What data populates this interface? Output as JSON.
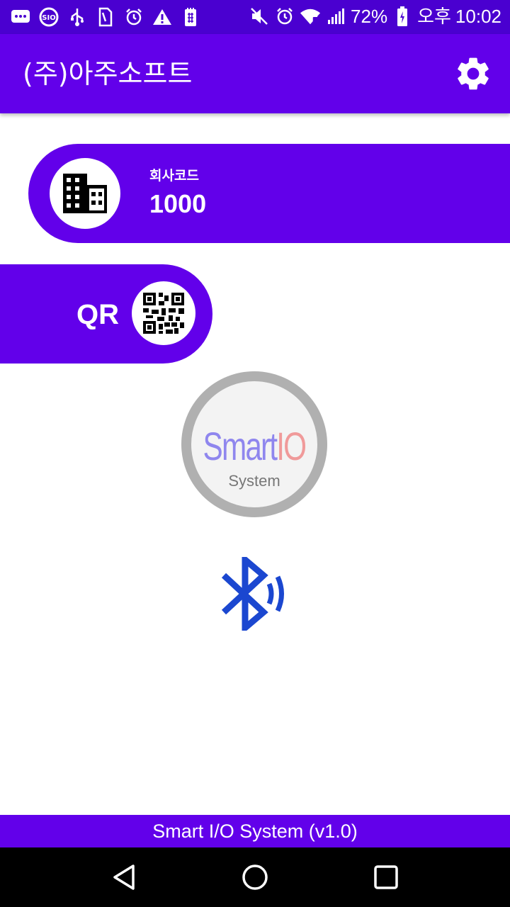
{
  "status_bar": {
    "battery_percent": "72%",
    "ampm": "오후",
    "time": "10:02",
    "left_icons": [
      "message-icon",
      "sio-app-icon",
      "usb-icon",
      "sim-icon",
      "alarm-icon",
      "warning-icon",
      "storage-icon"
    ],
    "right_icons": [
      "mute-icon",
      "alarm-icon",
      "wifi-icon",
      "signal-icon",
      "battery-icon"
    ]
  },
  "app_bar": {
    "title": "(주)아주소프트",
    "settings_icon": "gear-icon"
  },
  "company": {
    "label": "회사코드",
    "value": "1000",
    "icon": "building-icon"
  },
  "qr": {
    "label": "QR",
    "icon": "qr-code-icon"
  },
  "logo": {
    "smart": "Smart",
    "io": "IO",
    "system": "System"
  },
  "bluetooth": {
    "icon": "bluetooth-audio-icon"
  },
  "footer": {
    "text": "Smart I/O System (v1.0)"
  },
  "nav_bar": {
    "icons": [
      "back-icon",
      "home-icon",
      "recents-icon"
    ]
  },
  "colors": {
    "primary": "#6200ea",
    "status_bar": "#4a00d0",
    "bluetooth": "#1b47d0"
  }
}
